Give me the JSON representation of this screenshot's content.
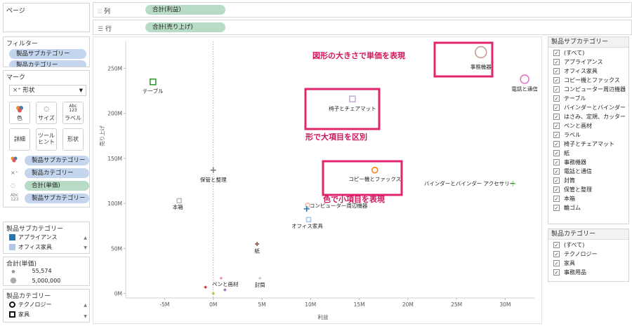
{
  "pages": {
    "title": "ページ"
  },
  "columns": {
    "label": "列",
    "pill": "合計(利益)"
  },
  "rows": {
    "label": "行",
    "pill": "合計(売り上げ)"
  },
  "filters": {
    "title": "フィルター",
    "items": [
      "製品サブカテゴリー",
      "製品カテゴリー"
    ]
  },
  "marks": {
    "title": "マーク",
    "type": "形状",
    "buttons": {
      "color": "色",
      "size": "サイズ",
      "label": "ラベル",
      "detail": "詳細",
      "tooltip_line1": "ツール",
      "tooltip_line2": "ヒント",
      "shape": "形状"
    },
    "label_icon_text": "Abc\n123",
    "fields": [
      "製品サブカテゴリー",
      "製品カテゴリー",
      "合計(単価)",
      "製品サブカテゴリー"
    ]
  },
  "color_legend": {
    "title": "製品サブカテゴリー",
    "items": [
      {
        "label": "アプライアンス",
        "color": "#1f77b4"
      },
      {
        "label": "オフィス家具",
        "color": "#aec7e8"
      }
    ]
  },
  "size_legend": {
    "title": "合計(単価)",
    "items": [
      "55,574",
      "5,000,000"
    ]
  },
  "shape_legend": {
    "title": "製品カテゴリー",
    "items": [
      "テクノロジー",
      "家具"
    ]
  },
  "subcat_filter": {
    "title": "製品サブカテゴリー",
    "items": [
      "(すべて)",
      "アプライアンス",
      "オフィス家具",
      "コピー機とファックス",
      "コンピューター周辺機器",
      "テーブル",
      "バインダーとバインダー ア...",
      "はさみ、定規、カッター",
      "ペンと画材",
      "ラベル",
      "椅子とチェアマット",
      "紙",
      "事務機器",
      "電話と通信",
      "封筒",
      "保管と整理",
      "本箱",
      "輪ゴム"
    ]
  },
  "cat_filter": {
    "title": "製品カテゴリー",
    "items": [
      "(すべて)",
      "テクノロジー",
      "家具",
      "事務用品"
    ]
  },
  "annotations": [
    "図形の大きさで単価を表現",
    "形で大項目を区別",
    "色で小項目を表現"
  ],
  "chart_data": {
    "type": "scatter",
    "xlabel": "利益",
    "ylabel": "売り上げ",
    "xlim": [
      -9,
      33
    ],
    "ylim": [
      -5,
      280
    ],
    "x_ticks": [
      -5,
      0,
      5,
      10,
      15,
      20,
      25,
      30
    ],
    "x_tick_labels": [
      "-5M",
      "0M",
      "5M",
      "10M",
      "15M",
      "20M",
      "25M",
      "30M"
    ],
    "y_ticks": [
      0,
      50,
      100,
      150,
      200,
      250
    ],
    "y_tick_labels": [
      "0M",
      "50M",
      "100M",
      "150M",
      "200M",
      "250M"
    ],
    "points": [
      {
        "label": "事務機器",
        "x": 27.5,
        "y": 268,
        "category": "テクノロジー",
        "shape": "circle",
        "color": "#c49c94",
        "size": 8,
        "lx": 0,
        "ly": 21
      },
      {
        "label": "電話と通信",
        "x": 32,
        "y": 238,
        "category": "テクノロジー",
        "shape": "circle",
        "color": "#e377c2",
        "size": 6,
        "lx": 0,
        "ly": 14
      },
      {
        "label": "テーブル",
        "x": -6.2,
        "y": 235,
        "category": "家具",
        "shape": "square",
        "color": "#2ca02c",
        "size": 4,
        "lx": 0,
        "ly": 13
      },
      {
        "label": "椅子とチェアマット",
        "x": 14.3,
        "y": 216,
        "category": "家具",
        "shape": "square",
        "color": "#c5b0d5",
        "size": 4,
        "lx": 0,
        "ly": 14
      },
      {
        "label": "コピー機とファックス",
        "x": 16.6,
        "y": 137,
        "category": "テクノロジー",
        "shape": "circle",
        "color": "#ff7f0e",
        "size": 4,
        "lx": 0,
        "ly": 13
      },
      {
        "label": "バインダーとバインダー アクセサリー",
        "x": 30.8,
        "y": 122,
        "category": "事務用品",
        "shape": "plus",
        "color": "#98df8a",
        "size": 4,
        "lx": -62,
        "ly": 0
      },
      {
        "label": "保管と整理",
        "x": 0,
        "y": 137,
        "category": "事務用品",
        "shape": "plus",
        "color": "#7f7f7f",
        "size": 4,
        "lx": 0,
        "ly": 14
      },
      {
        "label": "本箱",
        "x": -3.5,
        "y": 103,
        "category": "家具",
        "shape": "square",
        "color": "#bcbcbc",
        "size": 3,
        "lx": -2,
        "ly": 9
      },
      {
        "label": "コンピューター周辺機器",
        "x": 9.7,
        "y": 98,
        "category": "テクノロジー",
        "shape": "circle",
        "color": "#f7b6a2",
        "size": 3,
        "lx": 44,
        "ly": 1
      },
      {
        "label": "オフィス家具",
        "x": 9.8,
        "y": 82,
        "category": "家具",
        "shape": "square",
        "color": "#aec7e8",
        "size": 3,
        "lx": -2,
        "ly": 9
      },
      {
        "label": "アプライアンス",
        "x": 9.6,
        "y": 94,
        "category": "事務用品",
        "shape": "plus",
        "color": "#1f77b4",
        "size": 4,
        "lx": 0,
        "ly": 0
      },
      {
        "label": "紙",
        "x": 4.5,
        "y": 55,
        "category": "事務用品",
        "shape": "plus",
        "color": "#8c564b",
        "size": 3,
        "lx": 0,
        "ly": 10
      },
      {
        "label": "ペンと画材",
        "x": 0.8,
        "y": 17,
        "category": "事務用品",
        "shape": "plus",
        "color": "#e7969c",
        "size": 2,
        "lx": 6,
        "ly": 9
      },
      {
        "label": "封筒",
        "x": 4.8,
        "y": 17,
        "category": "事務用品",
        "shape": "plus",
        "color": "#c7c7c7",
        "size": 2,
        "lx": 0,
        "ly": 10
      },
      {
        "label": "はさみ、定規、カッター",
        "x": -0.8,
        "y": 7,
        "category": "事務用品",
        "shape": "plus",
        "color": "#d62728",
        "size": 2,
        "lx": 0,
        "ly": 0
      },
      {
        "label": "輪ゴム",
        "x": 1.2,
        "y": 4,
        "category": "事務用品",
        "shape": "plus",
        "color": "#9467bd",
        "size": 2,
        "lx": 0,
        "ly": 0
      },
      {
        "label": "ラベル",
        "x": 0,
        "y": 0,
        "category": "事務用品",
        "shape": "plus",
        "color": "#bcbd22",
        "size": 2,
        "lx": 0,
        "ly": 0
      }
    ]
  }
}
